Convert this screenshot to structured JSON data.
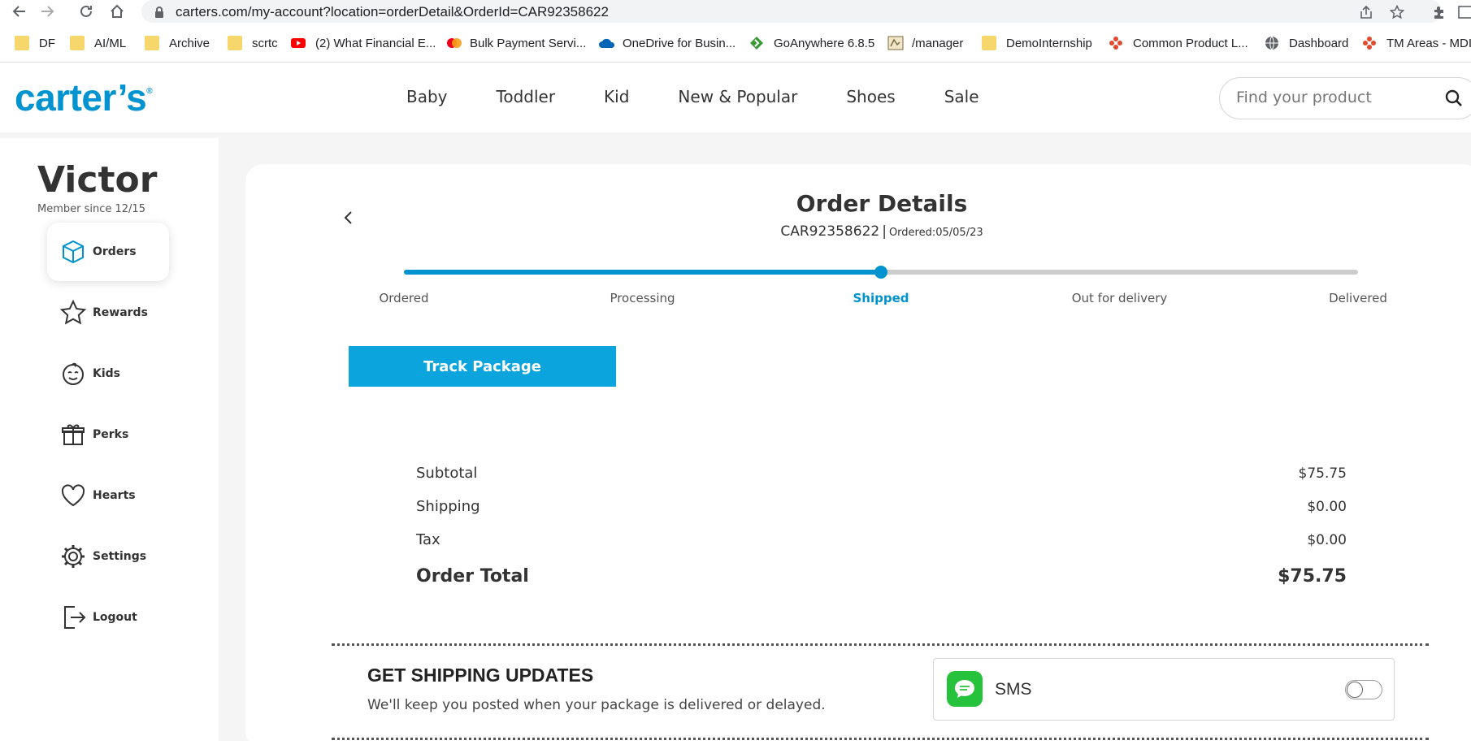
{
  "browser": {
    "url": "carters.com/my-account?location=orderDetail&OrderId=CAR92358622",
    "bookmarks": [
      {
        "label": "DF",
        "icon": "folder-icon"
      },
      {
        "label": "AI/ML",
        "icon": "folder-icon"
      },
      {
        "label": "Archive",
        "icon": "folder-icon"
      },
      {
        "label": "scrtc",
        "icon": "folder-icon"
      },
      {
        "label": "(2) What Financial E...",
        "icon": "youtube-icon"
      },
      {
        "label": "Bulk Payment Servi...",
        "icon": "mastercard-icon"
      },
      {
        "label": "OneDrive for Busin...",
        "icon": "onedrive-icon"
      },
      {
        "label": "GoAnywhere 6.8.5",
        "icon": "goanywhere-icon"
      },
      {
        "label": "/manager",
        "icon": "tomcat-icon"
      },
      {
        "label": "DemoInternship",
        "icon": "folder-icon"
      },
      {
        "label": "Common Product L...",
        "icon": "flower-icon"
      },
      {
        "label": "Dashboard",
        "icon": "globe-icon"
      },
      {
        "label": "TM Areas - MDI",
        "icon": "flower-icon"
      }
    ]
  },
  "header": {
    "logo": "carter’s",
    "nav": [
      "Baby",
      "Toddler",
      "Kid",
      "New & Popular",
      "Shoes",
      "Sale"
    ],
    "search_placeholder": "Find your product"
  },
  "sidebar": {
    "user_name": "Victor",
    "member_since": "Member since 12/15",
    "items": [
      {
        "label": "Orders",
        "icon": "box-icon",
        "active": true
      },
      {
        "label": "Rewards",
        "icon": "star-icon",
        "active": false
      },
      {
        "label": "Kids",
        "icon": "baby-face-icon",
        "active": false
      },
      {
        "label": "Perks",
        "icon": "gift-icon",
        "active": false
      },
      {
        "label": "Hearts",
        "icon": "heart-icon",
        "active": false
      },
      {
        "label": "Settings",
        "icon": "gear-icon",
        "active": false
      },
      {
        "label": "Logout",
        "icon": "logout-icon",
        "active": false
      }
    ]
  },
  "order": {
    "title": "Order Details",
    "order_id": "CAR92358622",
    "separator": "|",
    "ordered_date": "Ordered:05/05/23",
    "steps": [
      "Ordered",
      "Processing",
      "Shipped",
      "Out for delivery",
      "Delivered"
    ],
    "current_step_index": 2,
    "progress_fraction": 0.5,
    "track_button": "Track Package",
    "summary": [
      {
        "label": "Subtotal",
        "value": "$75.75"
      },
      {
        "label": "Shipping",
        "value": "$0.00"
      },
      {
        "label": "Tax",
        "value": "$0.00"
      }
    ],
    "total": {
      "label": "Order Total",
      "value": "$75.75"
    }
  },
  "shipping_updates": {
    "title": "GET SHIPPING UPDATES",
    "description": "We'll keep you posted when your package is delivered or delayed.",
    "channel_label": "SMS",
    "enabled": false
  },
  "colors": {
    "brand": "#0093d0",
    "button": "#0ca4dc",
    "sms_green": "#27c23b"
  }
}
